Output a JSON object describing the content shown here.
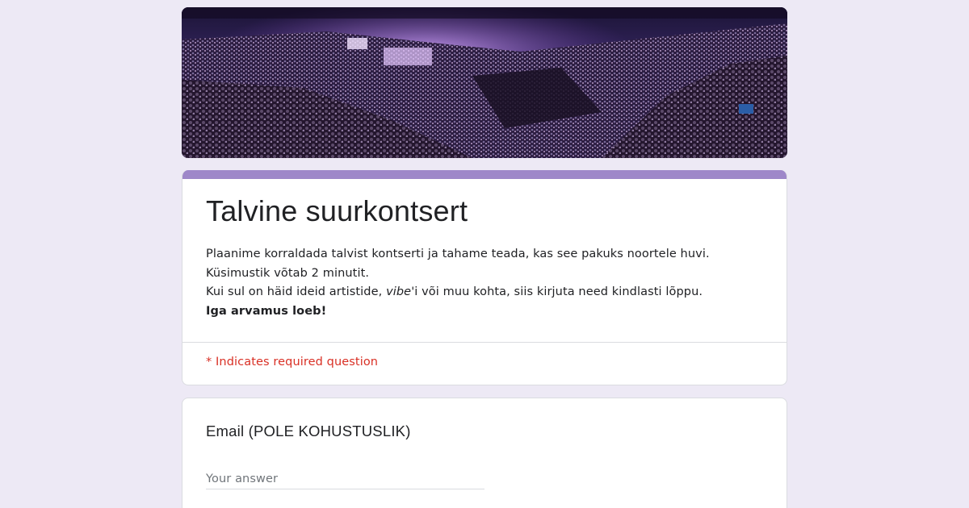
{
  "form": {
    "title": "Talvine suurkontsert",
    "description": {
      "line1": "Plaanime korraldada talvist kontserti ja tahame teada, kas see pakuks noortele huvi.",
      "line2": "Küsimustik võtab 2 minutit.",
      "line3_pre": "Kui sul on häid ideid artistide, ",
      "line3_italic": "vibe",
      "line3_post": "'i või muu kohta, siis kirjuta need kindlasti lõppu.",
      "line4": "Iga arvamus loeb!"
    },
    "required_note": "* Indicates required question",
    "accent_color": "#9e87c9",
    "background_color": "#ede9f5"
  },
  "questions": [
    {
      "title": "Email (POLE KOHUSTUSLIK)",
      "placeholder": "Your answer"
    }
  ]
}
